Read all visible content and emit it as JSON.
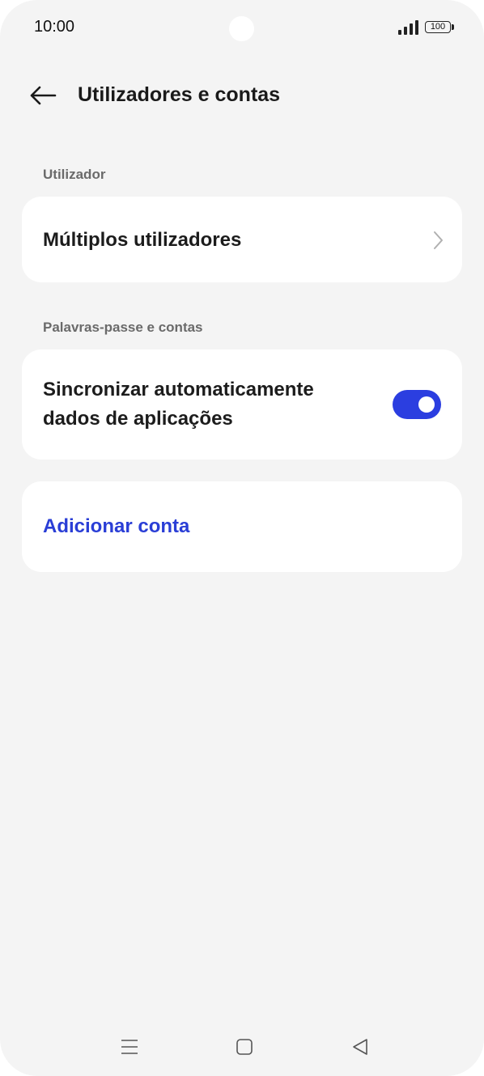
{
  "status_bar": {
    "time": "10:00",
    "battery": "100",
    "signal_icon": "signal-icon"
  },
  "header": {
    "title": "Utilizadores e contas",
    "back_icon": "back-arrow-icon"
  },
  "sections": {
    "user_label": "Utilizador",
    "passwords_label": "Palavras-passe e contas"
  },
  "items": {
    "multiple_users": "Múltiplos utilizadores",
    "auto_sync_line1": "Sincronizar automaticamente",
    "auto_sync_line2": "dados de aplicações",
    "auto_sync_enabled": true,
    "add_account": "Adicionar conta"
  },
  "nav_bar": {
    "menu_icon": "menu-icon",
    "home_icon": "home-icon",
    "back_icon": "back-triangle-icon"
  },
  "colors": {
    "accent": "#2b3ee0",
    "background": "#f4f4f4",
    "card": "#ffffff",
    "section_label": "#6a6a6a"
  }
}
